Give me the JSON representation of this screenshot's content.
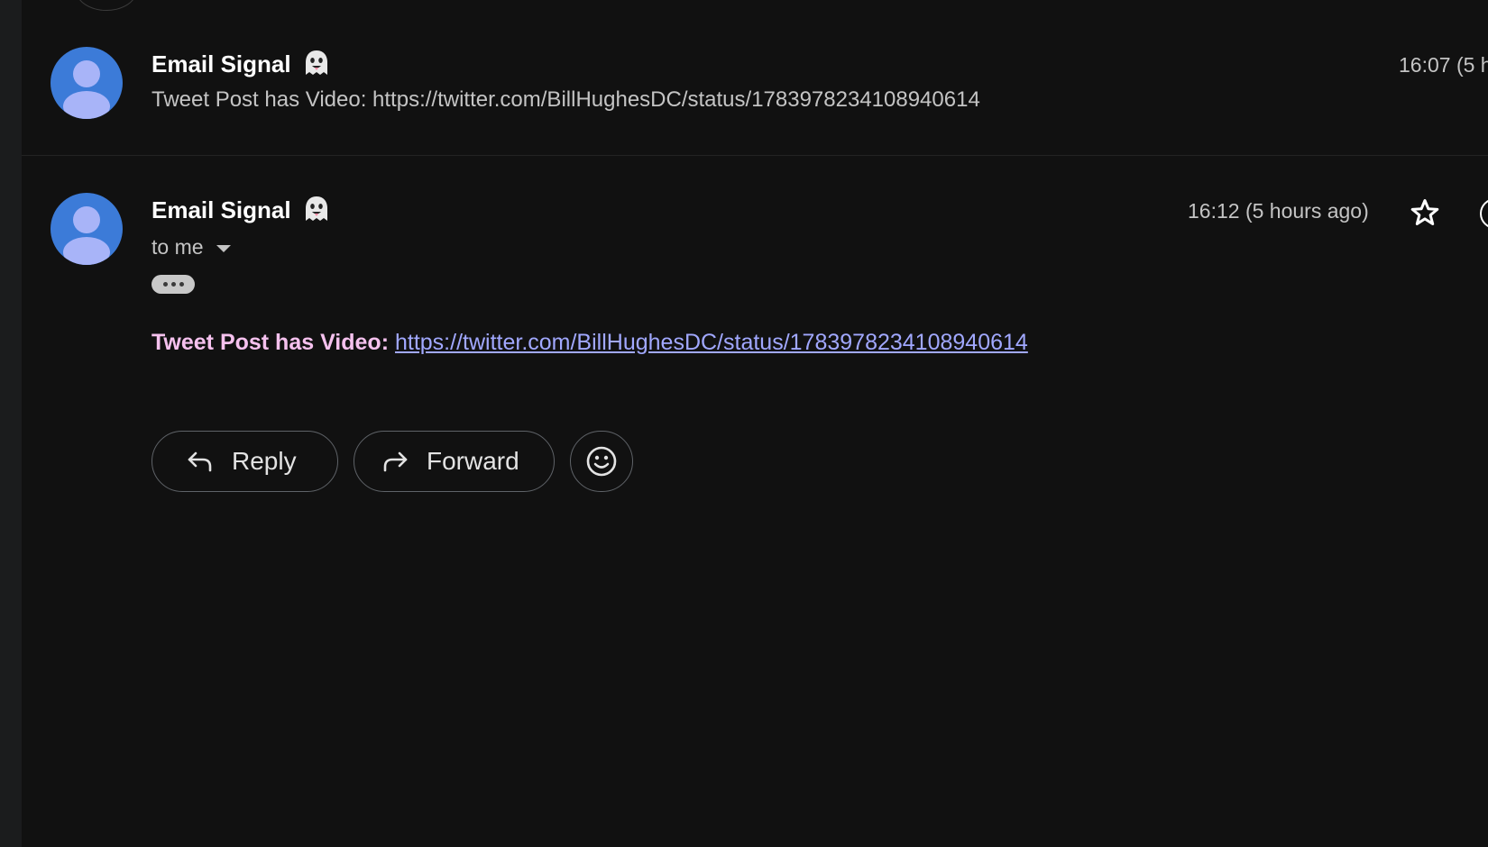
{
  "thread": {
    "collapsed_message": {
      "sender": "Email Signal",
      "sender_emoji": "ghost-emoji",
      "snippet": "Tweet Post has Video: https://twitter.com/BillHughesDC/status/1783978234108940614",
      "time": "16:07 (5 h"
    },
    "expanded_message": {
      "sender": "Email Signal",
      "sender_emoji": "ghost-emoji",
      "time": "16:12 (5 hours ago)",
      "recipient": "to me",
      "body_label": "Tweet Post has Video:",
      "body_link": "https://twitter.com/BillHughesDC/status/1783978234108940614"
    },
    "actions": {
      "reply_label": "Reply",
      "forward_label": "Forward"
    }
  },
  "colors": {
    "background": "#111111",
    "avatar": "#3c7bd8",
    "avatar_glyph": "#a8b4f8",
    "body_label": "#f5c1ee",
    "link": "#a1a8ff"
  }
}
